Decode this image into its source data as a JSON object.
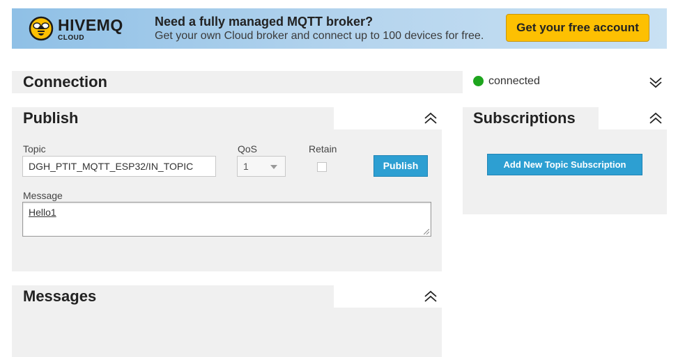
{
  "banner": {
    "logo_text": "HIVEMQ",
    "logo_sub": "CLOUD",
    "headline": "Need a fully managed MQTT broker?",
    "subline": "Get your own Cloud broker and connect up to 100 devices for free.",
    "cta_label": "Get your free account"
  },
  "connection": {
    "title": "Connection",
    "status": "connected",
    "status_color": "#1ea51e"
  },
  "publish": {
    "title": "Publish",
    "topic_label": "Topic",
    "topic_value": "DGH_PTIT_MQTT_ESP32/IN_TOPIC",
    "qos_label": "QoS",
    "qos_value": "1",
    "retain_label": "Retain",
    "retain_checked": false,
    "button_label": "Publish",
    "message_label": "Message",
    "message_value": "Hello1"
  },
  "subscriptions": {
    "title": "Subscriptions",
    "add_button_label": "Add New Topic Subscription"
  },
  "messages": {
    "title": "Messages"
  },
  "colors": {
    "accent_blue": "#2d9fd2",
    "cta_yellow": "#fdc002",
    "panel_gray": "#f0f0f0"
  }
}
